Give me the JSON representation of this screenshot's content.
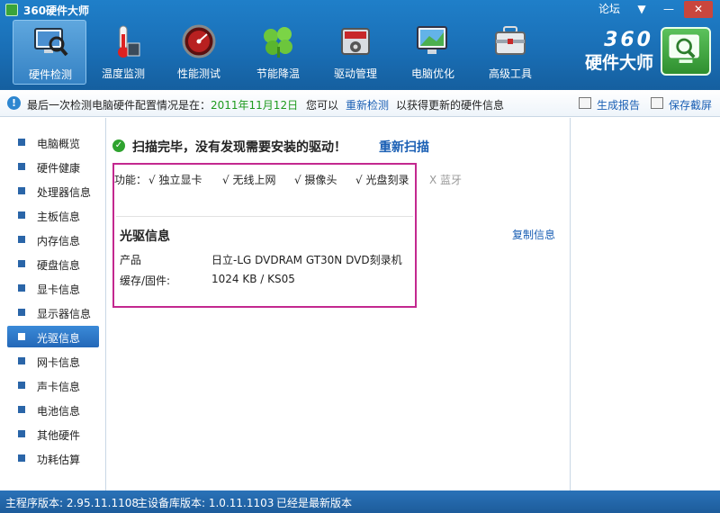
{
  "window": {
    "title": "360硬件大师",
    "forum": "论坛",
    "menu": "▼",
    "minimize": "—",
    "close": "✕"
  },
  "toolbar": [
    {
      "label": "硬件检测",
      "icon": "hardware-detect-icon"
    },
    {
      "label": "温度监测",
      "icon": "thermometer-icon"
    },
    {
      "label": "性能测试",
      "icon": "speedometer-icon"
    },
    {
      "label": "节能降温",
      "icon": "leaf-icon"
    },
    {
      "label": "驱动管理",
      "icon": "driver-icon"
    },
    {
      "label": "电脑优化",
      "icon": "optimize-icon"
    },
    {
      "label": "高级工具",
      "icon": "toolbox-icon"
    }
  ],
  "brand": {
    "num": "360",
    "name": "硬件大师"
  },
  "infobar": {
    "prefix": "最后一次检测电脑硬件配置情况是在：",
    "date": "2011年11月12日",
    "middle": "您可以",
    "recheck": "重新检测",
    "suffix": "以获得更新的硬件信息",
    "report": "生成报告",
    "screenshot": "保存截屏"
  },
  "sidebar": {
    "items": [
      "电脑概览",
      "硬件健康",
      "处理器信息",
      "主板信息",
      "内存信息",
      "硬盘信息",
      "显卡信息",
      "显示器信息",
      "光驱信息",
      "网卡信息",
      "声卡信息",
      "电池信息",
      "其他硬件",
      "功耗估算"
    ],
    "active_index": 8
  },
  "main": {
    "scan_message": "扫描完毕，没有发现需要安装的驱动！",
    "rescan": "重新扫描",
    "features_label": "功能：",
    "features": [
      {
        "label": "√ 独立显卡",
        "enabled": true
      },
      {
        "label": "√ 无线上网",
        "enabled": true
      },
      {
        "label": "√ 摄像头",
        "enabled": true
      },
      {
        "label": "√ 光盘刻录",
        "enabled": true
      },
      {
        "label": "X 蓝牙",
        "enabled": false
      }
    ],
    "section_title": "光驱信息",
    "copy_info": "复制信息",
    "rows": [
      {
        "key": "产品",
        "value": "日立-LG DVDRAM GT30N DVD刻录机"
      },
      {
        "key": "缓存/固件:",
        "value": "1024 KB / KS05"
      }
    ]
  },
  "status": {
    "main_version": "主程序版本: 2.95.11.1108",
    "db_version": "主设备库版本: 1.0.11.1103",
    "latest": "已经是最新版本"
  }
}
